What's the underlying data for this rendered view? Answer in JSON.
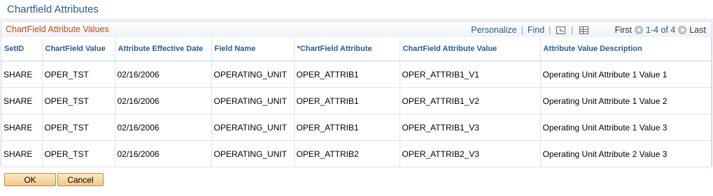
{
  "page": {
    "title": "Chartfield Attributes"
  },
  "grid": {
    "title": "ChartField Attribute Values",
    "nav": {
      "personalize": "Personalize",
      "find": "Find",
      "first": "First",
      "range": "1-4 of 4",
      "last": "Last"
    },
    "columns": [
      "SetID",
      "ChartField Value",
      "Attribute Effective Date",
      "Field Name",
      "*ChartField Attribute",
      "ChartField Attribute Value",
      "Attribute Value Description"
    ],
    "rows": [
      [
        "SHARE",
        "OPER_TST",
        "02/16/2006",
        "OPERATING_UNIT",
        "OPER_ATTRIB1",
        "OPER_ATTRIB1_V1",
        "Operating Unit Attribute 1 Value 1"
      ],
      [
        "SHARE",
        "OPER_TST",
        "02/16/2006",
        "OPERATING_UNIT",
        "OPER_ATTRIB1",
        "OPER_ATTRIB1_V2",
        "Operating Unit Attribute 1 Value 2"
      ],
      [
        "SHARE",
        "OPER_TST",
        "02/16/2006",
        "OPERATING_UNIT",
        "OPER_ATTRIB1",
        "OPER_ATTRIB1_V3",
        "Operating Unit Attribute 1 Value 3"
      ],
      [
        "SHARE",
        "OPER_TST",
        "02/16/2006",
        "OPERATING_UNIT",
        "OPER_ATTRIB2",
        "OPER_ATTRIB2_V3",
        "Operating Unit Attribute 2 Value 3"
      ]
    ]
  },
  "buttons": {
    "ok": "OK",
    "cancel": "Cancel"
  },
  "icons": {
    "zoom": "zoom-grid-icon",
    "download": "download-grid-icon",
    "prev": "previous-arrow-icon",
    "next": "next-arrow-icon"
  },
  "colors": {
    "title": "#2b5a8c",
    "grid_title": "#b3501a",
    "button": "#f3c887"
  }
}
